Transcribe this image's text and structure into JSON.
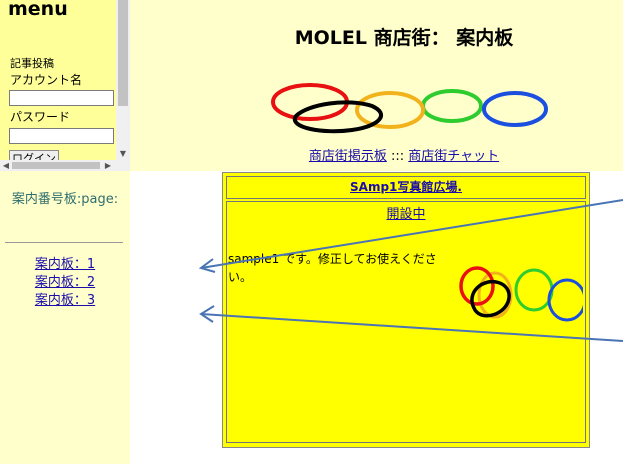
{
  "menu": {
    "title": "menu",
    "post_label": "記事投稿",
    "account_label": "アカウント名",
    "password_label": "パスワード",
    "login_button": "ログイン"
  },
  "left": {
    "index_label": "案内番号板:page:",
    "boards": [
      "案内板：1",
      "案内板：2",
      "案内板：3"
    ]
  },
  "header": {
    "title": "MOLEL 商店街： 案内板",
    "links": [
      "商店街掲示板",
      "商店街チャット"
    ],
    "separator": " ::: "
  },
  "board": {
    "header_link": "SAmp1写真館広場.",
    "status": "開設中",
    "message": "sample1 です。修正してお使えください。"
  },
  "colors": {
    "banner_bg": "#ffffcc",
    "menu_bg": "#ffff99",
    "board_bg": "#ffff00",
    "link": "#1a0dab",
    "arrow": "#4a74b4",
    "ring_red": "#e81010",
    "ring_yellow": "#f2b21c",
    "ring_green": "#2ecc2e",
    "ring_blue": "#1a4fe0",
    "ring_black": "#000000"
  }
}
